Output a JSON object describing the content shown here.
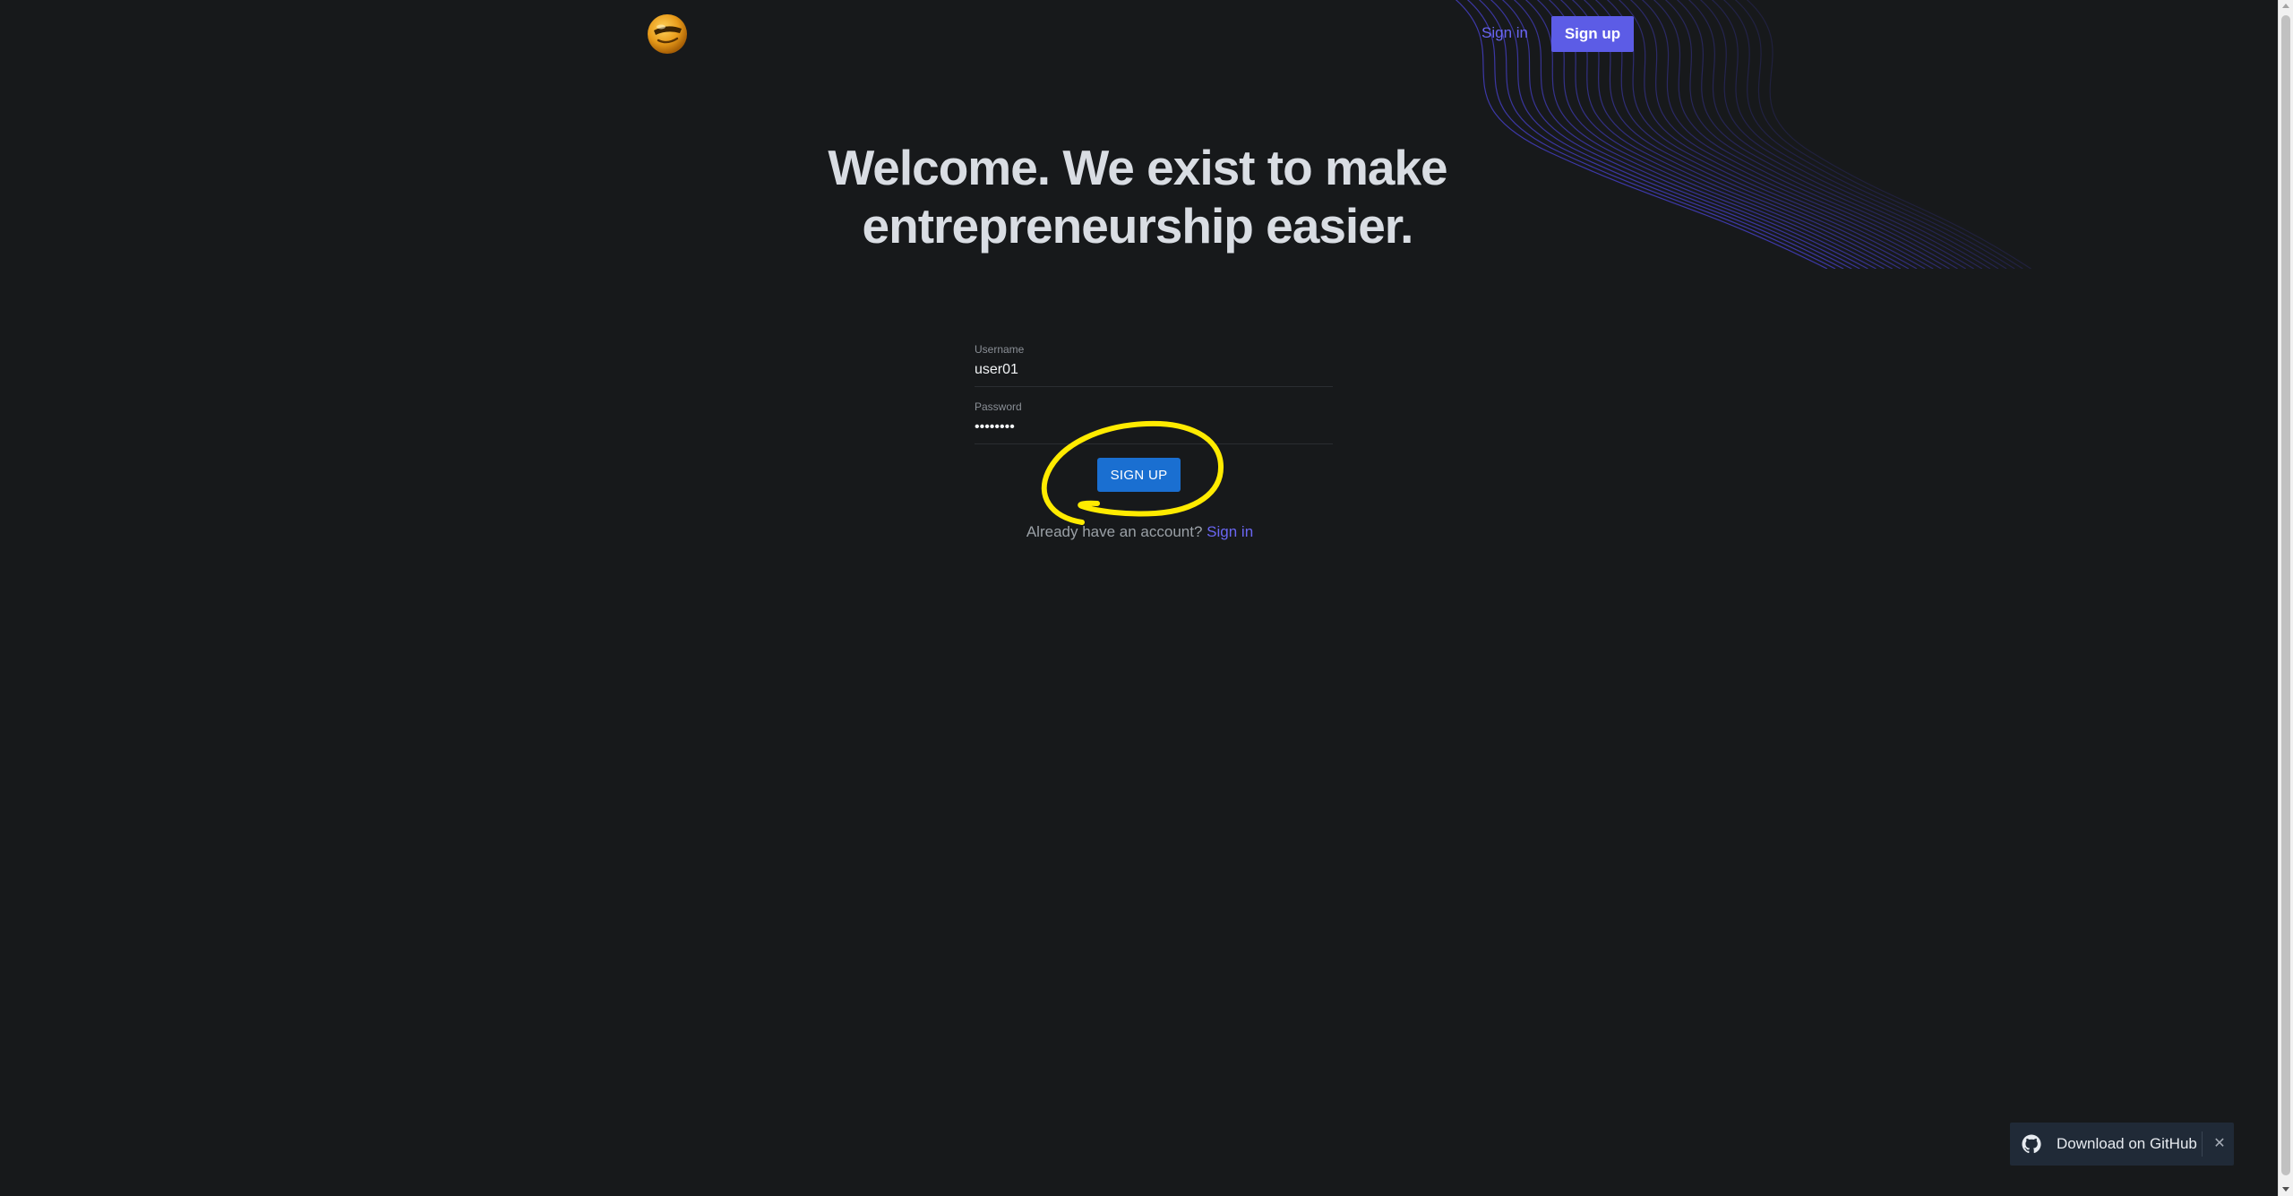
{
  "header": {
    "logo_icon": "emoji-face-logo-icon",
    "signin_label": "Sign in",
    "signup_label": "Sign up"
  },
  "hero": {
    "title_line1": "Welcome. We exist to make",
    "title_line2": "entrepreneurship easier."
  },
  "form": {
    "username_label": "Username",
    "username_value": "user01",
    "password_label": "Password",
    "password_value": "••••••••",
    "submit_label": "SIGN UP",
    "already_text": "Already have an account?",
    "signin_link": "Sign in"
  },
  "github_toast": {
    "icon": "github-icon",
    "label": "Download on GitHub",
    "close_glyph": "✕"
  },
  "colors": {
    "background": "#17191b",
    "accent": "#5c5ce6",
    "link": "#6a66f2",
    "primary_button": "#1a6fd1",
    "annotation": "#ffeb00"
  }
}
